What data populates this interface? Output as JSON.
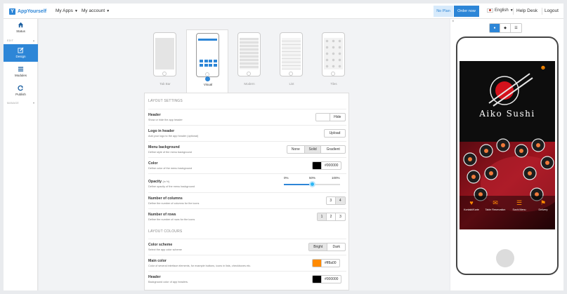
{
  "topbar": {
    "logo_text": "AppYourself",
    "logo_letter": "Y",
    "my_apps": "My Apps",
    "my_account": "My account",
    "no_plan": "No Plan",
    "order_now": "Order now",
    "language": "English",
    "help_desk": "Help Desk",
    "logout": "Logout"
  },
  "sidebar": {
    "items": [
      {
        "label": "Status",
        "icon": "home-icon"
      },
      {
        "label": "Design",
        "icon": "edit-icon",
        "active": true
      },
      {
        "label": "Modules",
        "icon": "list-icon"
      },
      {
        "label": "Publish",
        "icon": "refresh-icon"
      }
    ],
    "section_edit": "EDIT",
    "section_manage": "MANAGE"
  },
  "layouts": {
    "options": [
      "Tab Bar",
      "Visual",
      "Modern",
      "List",
      "Tiles"
    ],
    "selected": "Visual"
  },
  "layout_settings": {
    "title": "LAYOUT SETTINGS",
    "header": {
      "title": "Header",
      "desc": "Show or hide the app header",
      "value": "Hide"
    },
    "logo": {
      "title": "Logo in header",
      "desc": "Add your logo to the app header (optional)",
      "button": "Upload"
    },
    "menu_bg": {
      "title": "Menu background",
      "desc": "Define style of the menu background",
      "options": [
        "None",
        "Solid",
        "Gradient"
      ],
      "selected": "Solid"
    },
    "color": {
      "title": "Color",
      "desc": "Define color of the menu background",
      "value": "#000000"
    },
    "opacity": {
      "title": "Opacity",
      "unit": "(in %)",
      "desc": "Define opacity of the menu background",
      "ticks": [
        "0%",
        "50%",
        "100%"
      ],
      "value": 0.5
    },
    "columns": {
      "title": "Number of columns",
      "desc": "Define the number of columns for the icons",
      "options": [
        "3",
        "4"
      ],
      "selected": "4"
    },
    "rows": {
      "title": "Number of rows",
      "desc": "Define the number of rows for the icons",
      "options": [
        "1",
        "2",
        "3"
      ],
      "selected": "1"
    }
  },
  "layout_colours": {
    "title": "LAYOUT COLOURS",
    "scheme": {
      "title": "Color scheme",
      "desc": "Select the app color scheme",
      "options": [
        "Bright",
        "Dark"
      ],
      "selected": "Bright"
    },
    "main": {
      "title": "Main color",
      "desc": "Color of several interface elements, for example buttons, icons in lists, checkboxes etc.",
      "value": "#ff8a00"
    },
    "header": {
      "title": "Header",
      "desc": "Background color of app headers.",
      "value": "#000000"
    }
  },
  "preview": {
    "app_title": "Aiko Sushi",
    "tiles": [
      {
        "label": "Kontakt/Karte",
        "icon": "heart-icon"
      },
      {
        "label": "Table Reservation",
        "icon": "chat-icon"
      },
      {
        "label": "Sushi Menu",
        "icon": "book-icon"
      },
      {
        "label": "Delivery",
        "icon": "scooter-icon"
      }
    ],
    "colors": {
      "accent": "#ff8a00",
      "brand": "#2d86d7",
      "header": "#000000"
    }
  }
}
